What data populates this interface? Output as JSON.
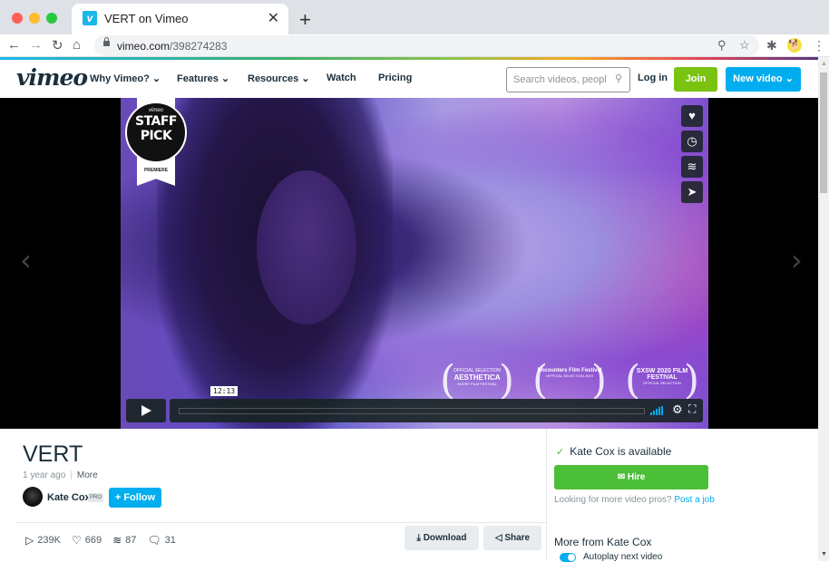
{
  "browser": {
    "tab_title": "VERT on Vimeo",
    "tab_favicon": "v",
    "close_glyph": "✕",
    "new_tab_glyph": "+",
    "url_host": "vimeo.com",
    "url_path": "/398274283",
    "nav_icons": {
      "back": "←",
      "forward": "→",
      "reload": "↻",
      "home": "⌂"
    },
    "omnibox_icons": {
      "zoom": "⚲",
      "bookmark": "☆"
    },
    "extension_icons": {
      "puzzle": "✱",
      "profile": "🐕",
      "menu": "⋮"
    },
    "traffic_light_colors": [
      "#ff5f57",
      "#febc2e",
      "#28c840"
    ]
  },
  "nav": {
    "logo": "vimeo",
    "links": [
      {
        "label": "Why Vimeo? ⌄"
      },
      {
        "label": "Features ⌄"
      },
      {
        "label": "Resources ⌄"
      },
      {
        "label": "Watch"
      },
      {
        "label": "Pricing"
      }
    ],
    "search_placeholder": "Search videos, people",
    "search_icon": "⚲",
    "login": "Log in",
    "join": "Join",
    "new_video": "New video ⌄"
  },
  "player": {
    "prev_arrow": "‹",
    "next_arrow": "›",
    "badge": {
      "brand": "vimeo",
      "line1": "STAFF",
      "line2": "PICK",
      "label": "PREMIERE"
    },
    "side_buttons": [
      {
        "name": "like",
        "glyph": "♥"
      },
      {
        "name": "watch-later",
        "glyph": "◷"
      },
      {
        "name": "collections",
        "glyph": "≋"
      },
      {
        "name": "share",
        "glyph": "➤"
      }
    ],
    "laurels": [
      {
        "top": "OFFICIAL SELECTION",
        "main": "AESTHETICA",
        "bottom": "SHORT FILM FESTIVAL"
      },
      {
        "top": "",
        "main": "Encounters Film Festival",
        "bottom": "OFFICIAL SELECTION 2019"
      },
      {
        "top": "",
        "main": "SXSW 2020 FILM FESTIVAL",
        "bottom": "OFFICIAL SELECTION"
      }
    ],
    "timecode": "12:13",
    "progress_fraction": 0,
    "settings_glyph": "⚙",
    "fullscreen_glyph": "⛶"
  },
  "video": {
    "title": "VERT",
    "age": "1 year ago",
    "more": "More",
    "author": "Kate Cox",
    "badge": "PRO",
    "follow": "+ Follow",
    "stats": [
      {
        "icon": "play-icon",
        "glyph": "▷",
        "value": "239K"
      },
      {
        "icon": "heart-icon",
        "glyph": "♡",
        "value": "669"
      },
      {
        "icon": "collections-icon",
        "glyph": "≋",
        "value": "87"
      },
      {
        "icon": "comment-icon",
        "glyph": "🗨",
        "value": "31"
      }
    ],
    "download": "⤓ Download",
    "share": "◁ Share"
  },
  "sidebar": {
    "check": "✓",
    "available": "Kate Cox is available",
    "hire": "✉ Hire",
    "pros_text": "Looking for more video pros?",
    "post_job": "Post a job",
    "more_from": "More from Kate Cox",
    "autoplay": "Autoplay next video",
    "autoplay_on": true
  },
  "colors": {
    "brand_blue": "#00adef",
    "join_green": "#7ac310",
    "hire_green": "#4cbf38",
    "text_dark": "#1a2e3b"
  }
}
